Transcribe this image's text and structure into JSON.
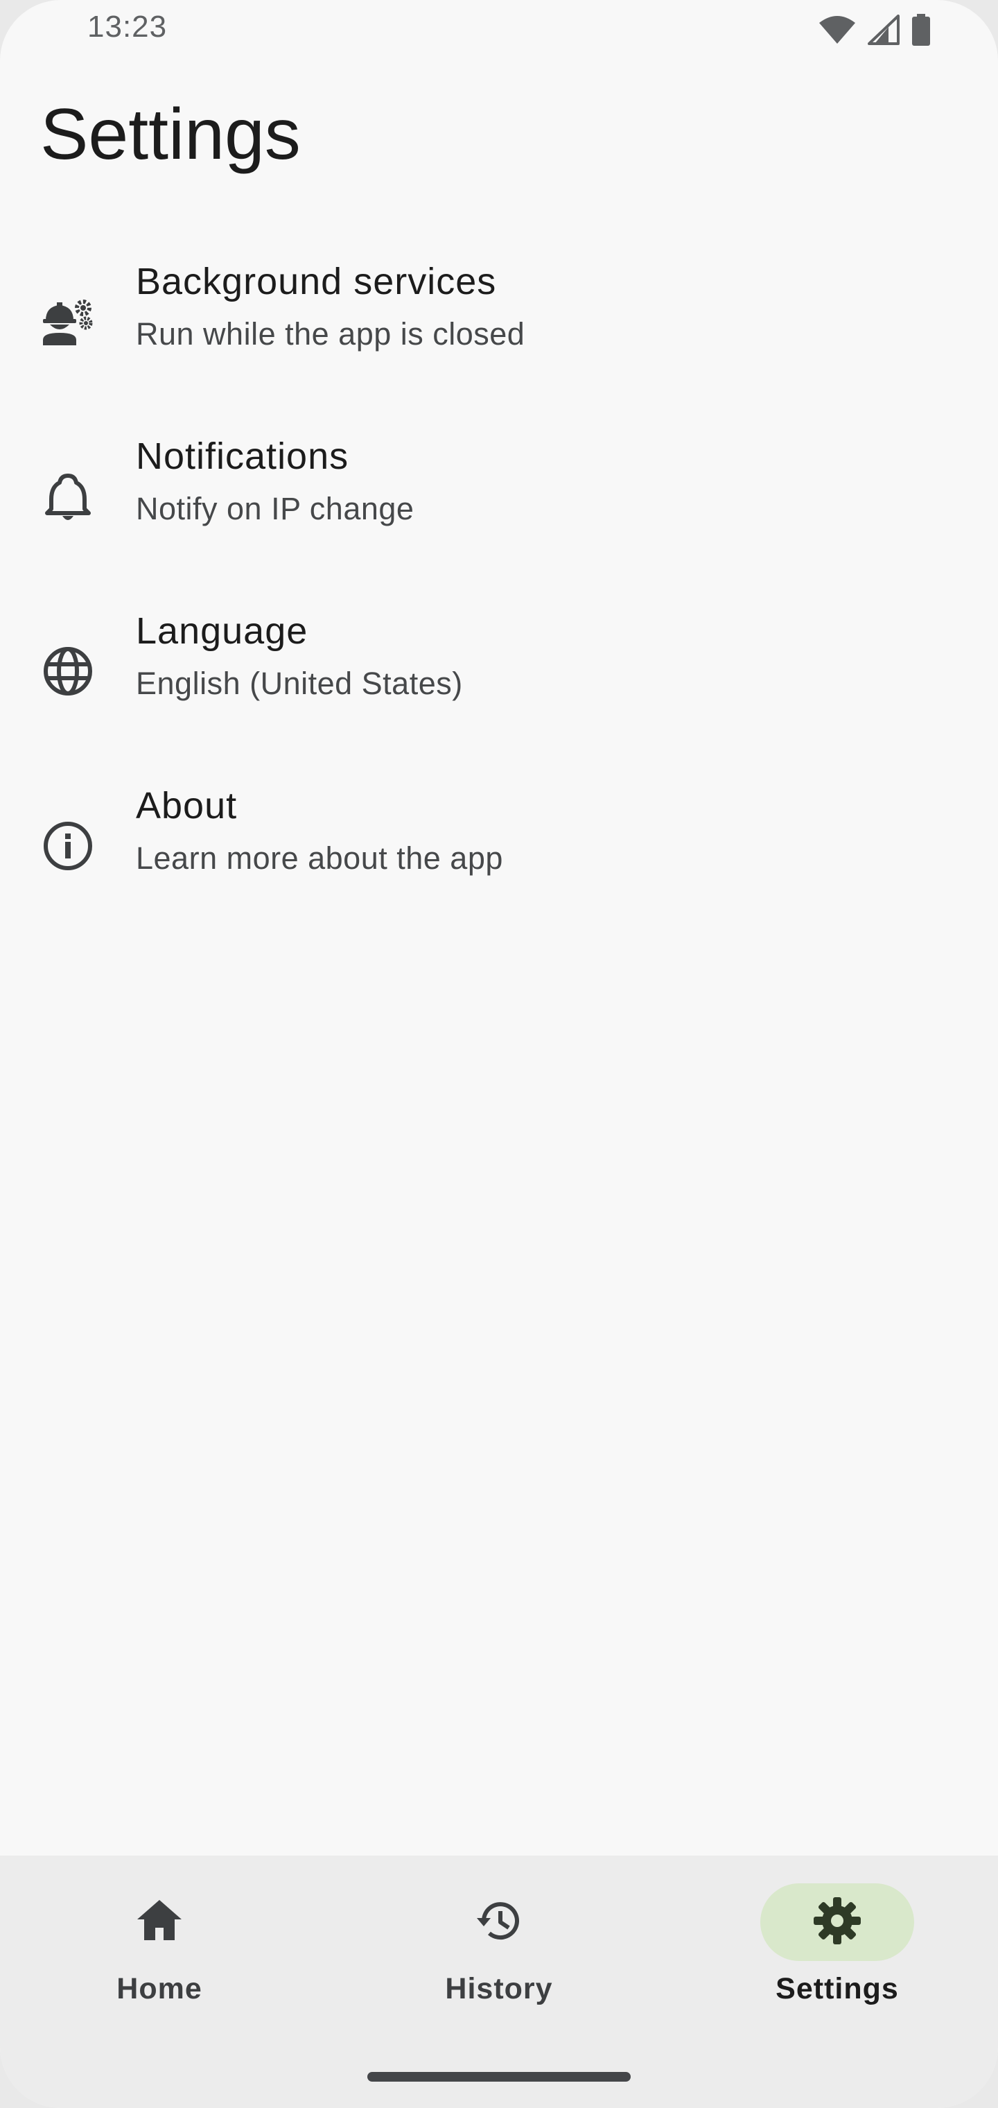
{
  "status_bar": {
    "time": "13:23",
    "icons": [
      "wifi-icon",
      "cellular-signal-icon",
      "battery-icon"
    ]
  },
  "page": {
    "title": "Settings"
  },
  "settings": {
    "items": [
      {
        "title": "Background services",
        "subtitle": "Run while the app is closed",
        "icon": "engineer-gear-icon"
      },
      {
        "title": "Notifications",
        "subtitle": "Notify on IP change",
        "icon": "bell-icon"
      },
      {
        "title": "Language",
        "subtitle": "English (United States)",
        "icon": "globe-icon"
      },
      {
        "title": "About",
        "subtitle": "Learn more about the app",
        "icon": "info-icon"
      }
    ]
  },
  "bottom_nav": {
    "items": [
      {
        "label": "Home",
        "icon": "home-icon",
        "active": false
      },
      {
        "label": "History",
        "icon": "history-icon",
        "active": false
      },
      {
        "label": "Settings",
        "icon": "gear-icon",
        "active": true
      }
    ]
  },
  "colors": {
    "background": "#f8f8f8",
    "nav_background": "#ececec",
    "active_pill": "#d9e8cb",
    "icon": "#3d3f41",
    "text_primary": "#1c1c1c",
    "text_secondary": "#46484a"
  }
}
